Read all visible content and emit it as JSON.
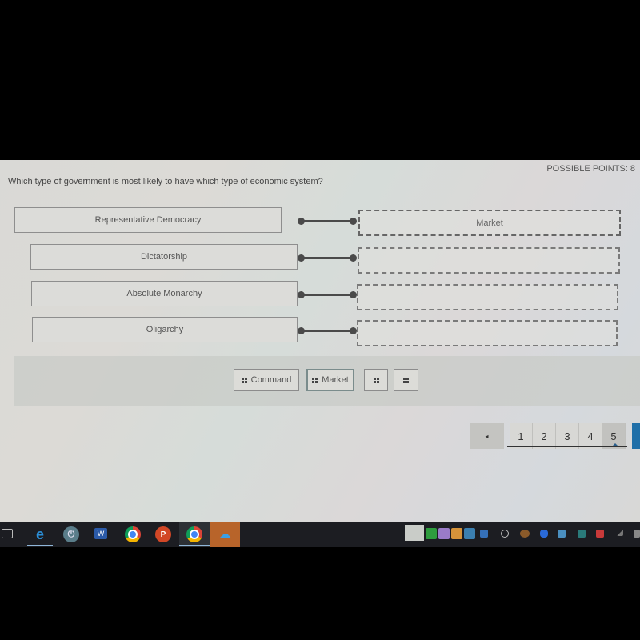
{
  "header": {
    "possible_points": "POSSIBLE POINTS: 8",
    "question": "Which type of government is most likely to have which type of economic system?"
  },
  "matching": {
    "left_items": [
      {
        "label": "Representative Democracy"
      },
      {
        "label": "Dictatorship"
      },
      {
        "label": "Absolute Monarchy"
      },
      {
        "label": "Oligarchy"
      }
    ],
    "right_slots": [
      {
        "value": "Market"
      },
      {
        "value": ""
      },
      {
        "value": ""
      },
      {
        "value": ""
      }
    ]
  },
  "answer_bank": {
    "chips": [
      {
        "label": "Command",
        "icon": "drag-grip-icon"
      },
      {
        "label": "Market",
        "icon": "drag-grip-icon",
        "selected": true
      },
      {
        "label": "",
        "icon": "drag-grip-icon"
      },
      {
        "label": "",
        "icon": "drag-grip-icon"
      }
    ]
  },
  "pagination": {
    "prev_label": "◂",
    "pages": [
      "1",
      "2",
      "3",
      "4",
      "5"
    ],
    "current_page": "5"
  },
  "taskbar": {
    "apps": [
      {
        "name": "task-view"
      },
      {
        "name": "edge",
        "glyph": "e"
      },
      {
        "name": "power-app",
        "glyph": "⏻"
      },
      {
        "name": "word",
        "glyph": "W"
      },
      {
        "name": "chrome"
      },
      {
        "name": "powerpoint",
        "glyph": "P"
      },
      {
        "name": "chrome-pinned"
      },
      {
        "name": "onedrive",
        "glyph": "☁"
      }
    ]
  },
  "colors": {
    "accent_blue": "#1f6fa8",
    "taskbar_bg": "#1c1d22",
    "connector": "#4a4a4a"
  }
}
